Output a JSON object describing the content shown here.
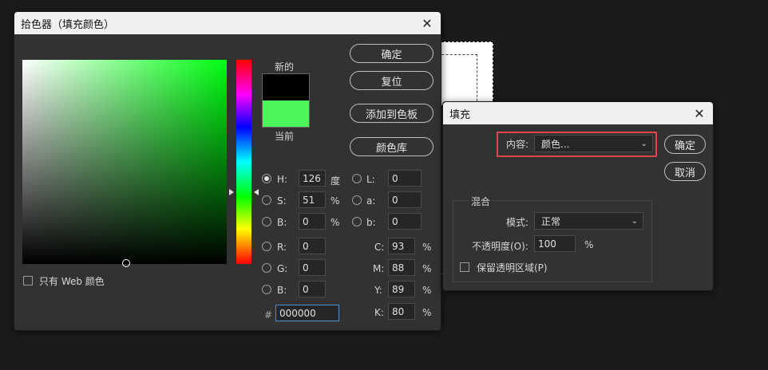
{
  "picker": {
    "title": "拾色器（填充颜色）",
    "new_label": "新的",
    "current_label": "当前",
    "new_color": "#000000",
    "current_color": "#4cf55a",
    "buttons": {
      "ok": "确定",
      "reset": "复位",
      "add_swatch": "添加到色板",
      "libraries": "颜色库"
    },
    "web_only_label": "只有 Web 颜色",
    "hsb": {
      "h": {
        "label": "H:",
        "value": "126",
        "unit": "度"
      },
      "s": {
        "label": "S:",
        "value": "51",
        "unit": "%"
      },
      "b": {
        "label": "B:",
        "value": "0",
        "unit": "%"
      }
    },
    "lab": {
      "l": {
        "label": "L:",
        "value": "0"
      },
      "a": {
        "label": "a:",
        "value": "0"
      },
      "b": {
        "label": "b:",
        "value": "0"
      }
    },
    "rgb": {
      "r": {
        "label": "R:",
        "value": "0"
      },
      "g": {
        "label": "G:",
        "value": "0"
      },
      "b": {
        "label": "B:",
        "value": "0"
      }
    },
    "cmyk": {
      "c": {
        "label": "C:",
        "value": "93",
        "unit": "%"
      },
      "m": {
        "label": "M:",
        "value": "88",
        "unit": "%"
      },
      "y": {
        "label": "Y:",
        "value": "89",
        "unit": "%"
      },
      "k": {
        "label": "K:",
        "value": "80",
        "unit": "%"
      }
    },
    "hex": {
      "label": "#",
      "value": "000000"
    },
    "field_hue_color": "#00ff11"
  },
  "fill": {
    "title": "填充",
    "content_label": "内容:",
    "content_value": "颜色...",
    "ok": "确定",
    "cancel": "取消",
    "blend_group": "混合",
    "mode_label": "模式:",
    "mode_value": "正常",
    "opacity_label": "不透明度(O):",
    "opacity_value": "100",
    "opacity_unit": "%",
    "preserve_label": "保留透明区域(P)",
    "highlight_color": "#e0474c"
  }
}
